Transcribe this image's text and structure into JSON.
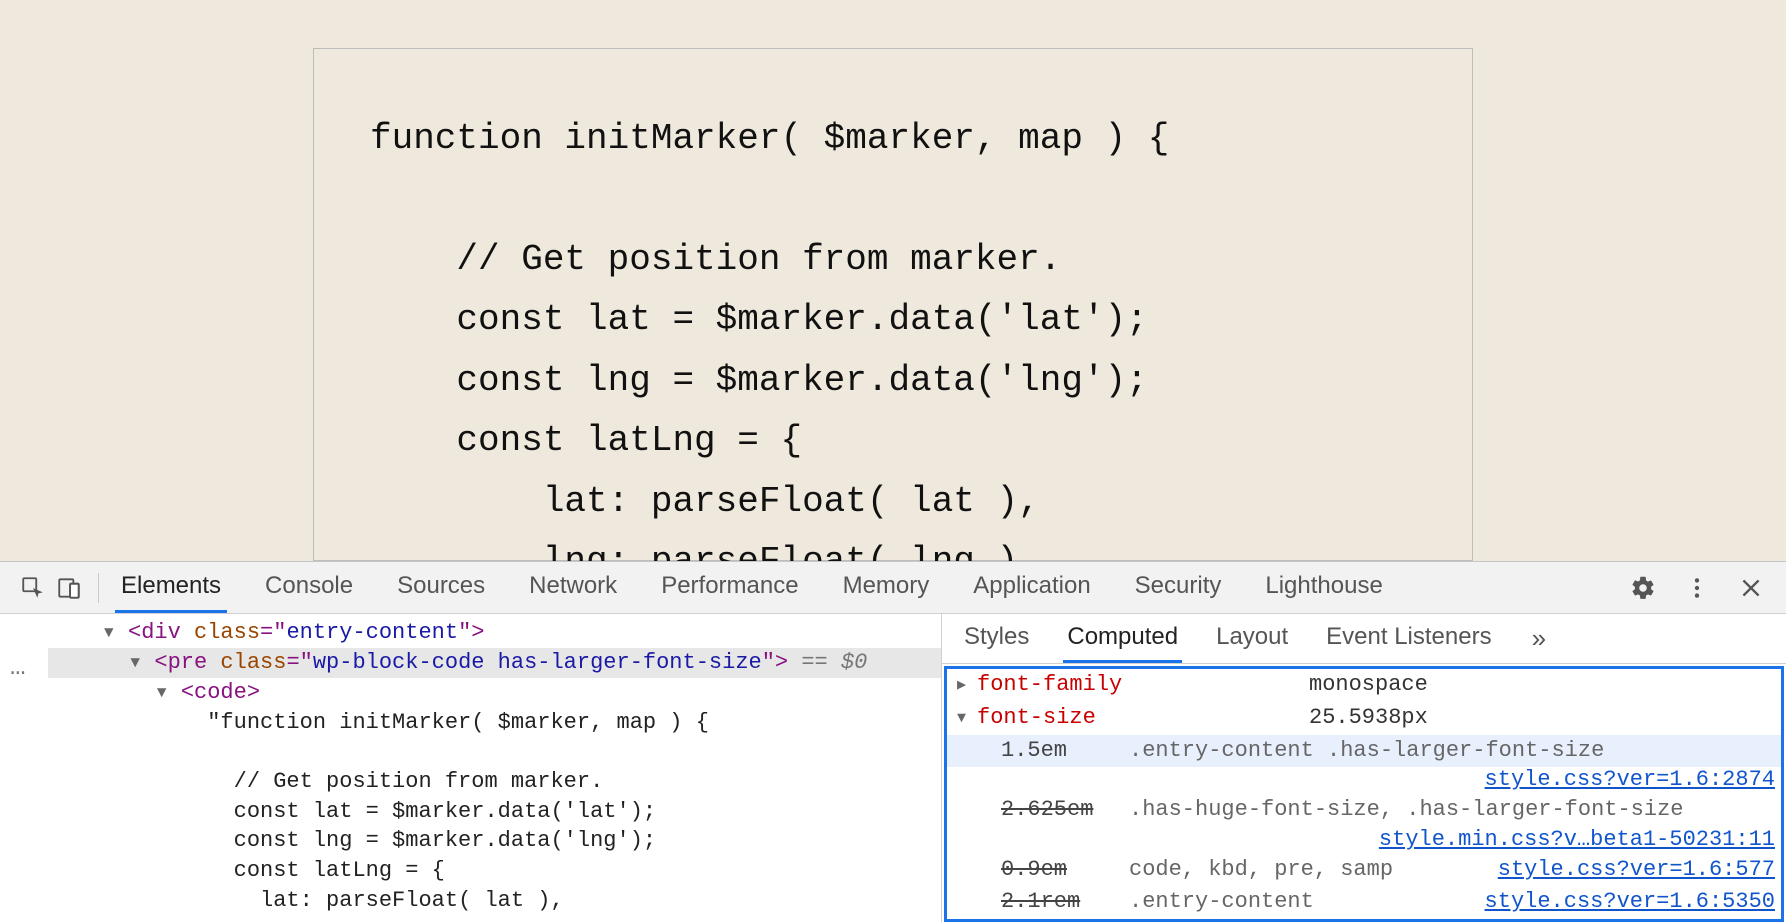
{
  "page": {
    "code_lines": [
      "function initMarker( $marker, map ) {",
      "",
      "    // Get position from marker.",
      "    const lat = $marker.data('lat');",
      "    const lng = $marker.data('lng');",
      "    const latLng = {",
      "        lat: parseFloat( lat ),",
      "        lng: parseFloat( lng )"
    ]
  },
  "devtools": {
    "main_tabs": [
      "Elements",
      "Console",
      "Sources",
      "Network",
      "Performance",
      "Memory",
      "Application",
      "Security",
      "Lighthouse"
    ],
    "main_active_index": 0,
    "sub_tabs": [
      "Styles",
      "Computed",
      "Layout",
      "Event Listeners"
    ],
    "sub_active_index": 1,
    "sub_more": "»",
    "dom": {
      "ellipsis": "…",
      "lines": [
        {
          "indent": 0,
          "tri": "▼",
          "segments": [
            {
              "t": "<",
              "c": "punct"
            },
            {
              "t": "div",
              "c": "tag-name"
            },
            {
              "t": " ",
              "c": ""
            },
            {
              "t": "class",
              "c": "attr-name"
            },
            {
              "t": "=\"",
              "c": "punct"
            },
            {
              "t": "entry-content",
              "c": "attr-val"
            },
            {
              "t": "\"",
              "c": "punct"
            },
            {
              "t": ">",
              "c": "punct"
            }
          ]
        },
        {
          "indent": 1,
          "tri": "▼",
          "selected": true,
          "segments": [
            {
              "t": "<",
              "c": "punct"
            },
            {
              "t": "pre",
              "c": "tag-name"
            },
            {
              "t": " ",
              "c": ""
            },
            {
              "t": "class",
              "c": "attr-name"
            },
            {
              "t": "=\"",
              "c": "punct"
            },
            {
              "t": "wp-block-code has-larger-font-size",
              "c": "attr-val"
            },
            {
              "t": "\"",
              "c": "punct"
            },
            {
              "t": ">",
              "c": "punct"
            },
            {
              "t": " == $0",
              "c": "eqdollar"
            }
          ]
        },
        {
          "indent": 2,
          "tri": "▼",
          "segments": [
            {
              "t": "<",
              "c": "punct"
            },
            {
              "t": "code",
              "c": "tag-name"
            },
            {
              "t": ">",
              "c": "punct"
            }
          ]
        },
        {
          "indent": 3,
          "segments": [
            {
              "t": "\"function initMarker( $marker, map ) {",
              "c": "text-node"
            }
          ]
        },
        {
          "indent": 3,
          "segments": [
            {
              "t": "",
              "c": "text-node"
            }
          ]
        },
        {
          "indent": 4,
          "segments": [
            {
              "t": "// Get position from marker.",
              "c": "text-node"
            }
          ]
        },
        {
          "indent": 4,
          "segments": [
            {
              "t": "const lat = $marker.data('lat');",
              "c": "text-node"
            }
          ]
        },
        {
          "indent": 4,
          "segments": [
            {
              "t": "const lng = $marker.data('lng');",
              "c": "text-node"
            }
          ]
        },
        {
          "indent": 4,
          "segments": [
            {
              "t": "const latLng = {",
              "c": "text-node"
            }
          ]
        },
        {
          "indent": 5,
          "segments": [
            {
              "t": "lat: parseFloat( lat ),",
              "c": "text-node"
            }
          ]
        }
      ]
    },
    "computed": {
      "props": [
        {
          "tri": "▶",
          "name": "font-family",
          "value": "monospace"
        },
        {
          "tri": "▼",
          "name": "font-size",
          "value": "25.5938px",
          "cascade": [
            {
              "val": "1.5em",
              "struck": false,
              "hl": true,
              "selector": ".entry-content .has-larger-font-size",
              "link": "style.css?ver=1.6:2874"
            },
            {
              "val": "2.625em",
              "struck": true,
              "hl": false,
              "selector": ".has-huge-font-size, .has-larger-font-size",
              "link": "style.min.css?v…beta1-50231:11"
            },
            {
              "val": "0.9em",
              "struck": true,
              "hl": false,
              "selector": "code, kbd, pre, samp",
              "link": "style.css?ver=1.6:577"
            },
            {
              "val": "2.1rem",
              "struck": true,
              "hl": false,
              "selector": ".entry-content",
              "link": "style.css?ver=1.6:5350"
            }
          ]
        }
      ]
    }
  }
}
